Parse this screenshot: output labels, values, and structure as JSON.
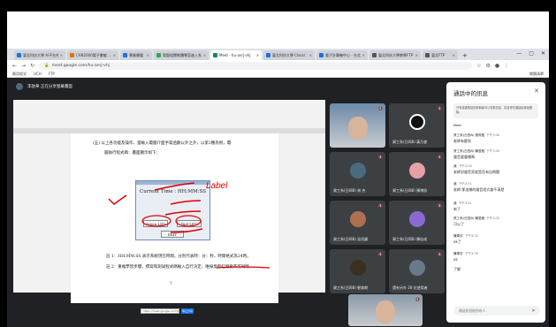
{
  "browser": {
    "tabs": [
      {
        "label": "臺北科技大學 Ai平台系統",
        "color": "#1a73e8"
      },
      {
        "label": "CAN2000電子書編 ...",
        "color": "#e8710a"
      },
      {
        "label": "專業書籍",
        "color": "#1a73e8"
      },
      {
        "label": "電腦相關軟體專案進入系 ...",
        "color": "#34a853"
      },
      {
        "label": "Meet - hu-anrj-vhj",
        "color": "#00897b",
        "active": true
      },
      {
        "label": "臺北科技大學 Classr ...",
        "color": "#1a73e8"
      },
      {
        "label": "電子計算機中心 - 台北 ...",
        "color": "#1a73e8"
      },
      {
        "label": "臺北科技大學教學FTP",
        "color": "#555555"
      },
      {
        "label": "臺北FTP",
        "color": "#555555"
      }
    ],
    "window_controls": [
      "—",
      "▢",
      "✕"
    ],
    "url": "meet.google.com/hu-anrj-vhj",
    "bookmarks": [
      "應用程式",
      "UCH",
      "FTP"
    ],
    "bookmarks_right": "閱讀清單"
  },
  "meet": {
    "presenting_label": "李啟華 正在分享螢幕畫面",
    "tiles": [
      {
        "name": "",
        "color": "#6d8aa8",
        "camera": true
      },
      {
        "name": "資工系(日四B) 黃乃睿",
        "color": "#ffffff",
        "logo": true
      },
      {
        "name": "資工系(日四B) 林 杰",
        "color": "#4a6a80"
      },
      {
        "name": "資工系(日四B) 陳博鈞",
        "color": "#e8a0a8"
      },
      {
        "name": "資工系(日四B) 吳岳穎",
        "color": "#b07050"
      },
      {
        "name": "資工系(日四B) 陳佳成",
        "color": "#8a6ad0"
      },
      {
        "name": "資工系(日四B) 劉育朗",
        "color": "#3a3020"
      },
      {
        "name": "還有另外 28 位使用者",
        "color": "#6a7a8a"
      },
      {
        "name": "",
        "color": "#8a9aa8",
        "camera": true
      }
    ]
  },
  "slide": {
    "line1": "(五) 以上各功能及操作，當輸入電腦介面手寫函數以外之外，以第1種為例，電",
    "line2": "腦執行程式碼：畫面顯示如下：",
    "dialog_time": "Current Time : HH:MM:SS",
    "btn_green": "Green LED",
    "btn_red": "Red LED",
    "btn_exit": "EXIT",
    "note1": "註 1：HH:MM:SS 表示系統現在時間，分別代表時：分：秒，時間格式為24時。",
    "note2": "註 2：重複學習步驟，撰寫和測試程式碼輸入自行決定，唯綠燈和紅燈要不可同時。",
    "question_mark": "?",
    "zoom_field": "https://meet.google.com/hu-anrj",
    "zoom_button": "停止分享"
  },
  "ink": {
    "annotation": "Label"
  },
  "chat": {
    "title": "通話中的訊息",
    "close": "✕",
    "note": "只有這通電話的參與者可以查看訊息，訊息會在通話結束後刪除。",
    "messages": [
      {
        "sender": "Meet",
        "time": "",
        "text": ""
      },
      {
        "sender": "資工系(日四B) 張芮語",
        "time": "下午3:30",
        "text": "老師有聽到"
      },
      {
        "sender": "資工系(日四B) 陳昱程",
        "time": "下午3:30",
        "text": "聲音要重播嗎"
      },
      {
        "sender": "我",
        "time": "下午3:30",
        "text": "老師對聲音亮度是否有出問題"
      },
      {
        "sender": "我",
        "time": "下午3:31",
        "text": "老師:那這樣的聲音程式會不清楚"
      },
      {
        "sender": "我",
        "time": "下午3:31",
        "text": "有了"
      },
      {
        "sender": "資工系(日四B) 陳昱程",
        "time": "下午3:32",
        "text": "可以了"
      },
      {
        "sender": "陳韋宇",
        "time": "下午3:32",
        "text": "ok了"
      },
      {
        "sender": "陳韋宇",
        "time": "下午3:33",
        "text": "ok"
      },
      {
        "sender": "",
        "time": "",
        "text": "了解"
      }
    ],
    "input_placeholder": "傳送訊息給所有人",
    "send_icon": "➤"
  }
}
